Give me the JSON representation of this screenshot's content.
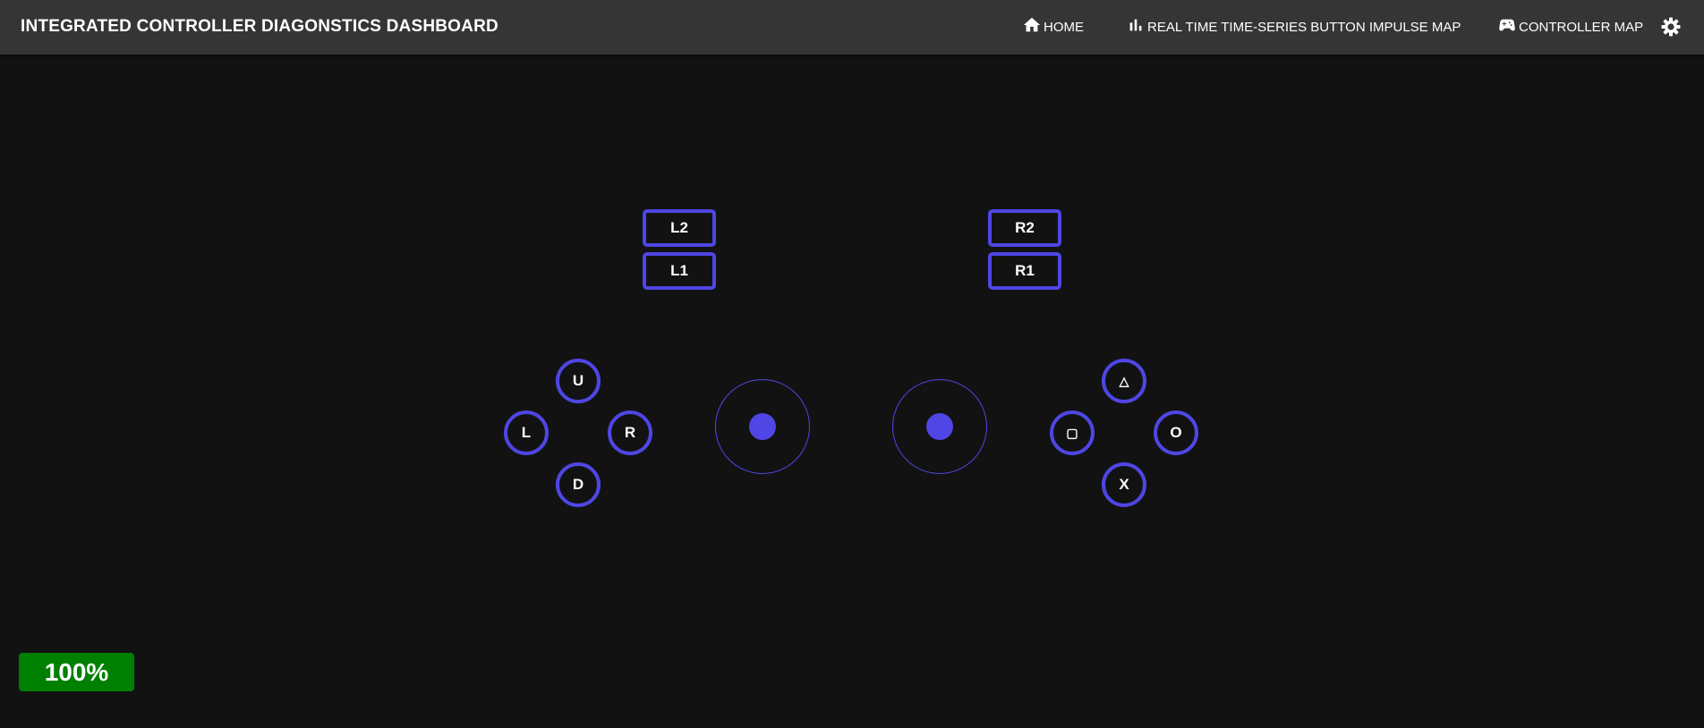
{
  "header": {
    "title": "INTEGRATED CONTROLLER DIAGONSTICS DASHBOARD",
    "nav": {
      "home": "HOME",
      "timeseries": "REAL TIME TIME-SERIES BUTTON IMPULSE MAP",
      "controller_map": "CONTROLLER MAP"
    }
  },
  "shoulders": {
    "l2": "L2",
    "l1": "L1",
    "r2": "R2",
    "r1": "R1"
  },
  "dpad": {
    "up": "U",
    "left": "L",
    "right": "R",
    "down": "D"
  },
  "face": {
    "triangle": "△",
    "square": "▢",
    "circle": "O",
    "cross": "X"
  },
  "battery": {
    "level": "100%"
  },
  "colors": {
    "accent": "#4f46e5",
    "background": "#121212",
    "header": "#353535",
    "battery_ok": "#008000"
  }
}
